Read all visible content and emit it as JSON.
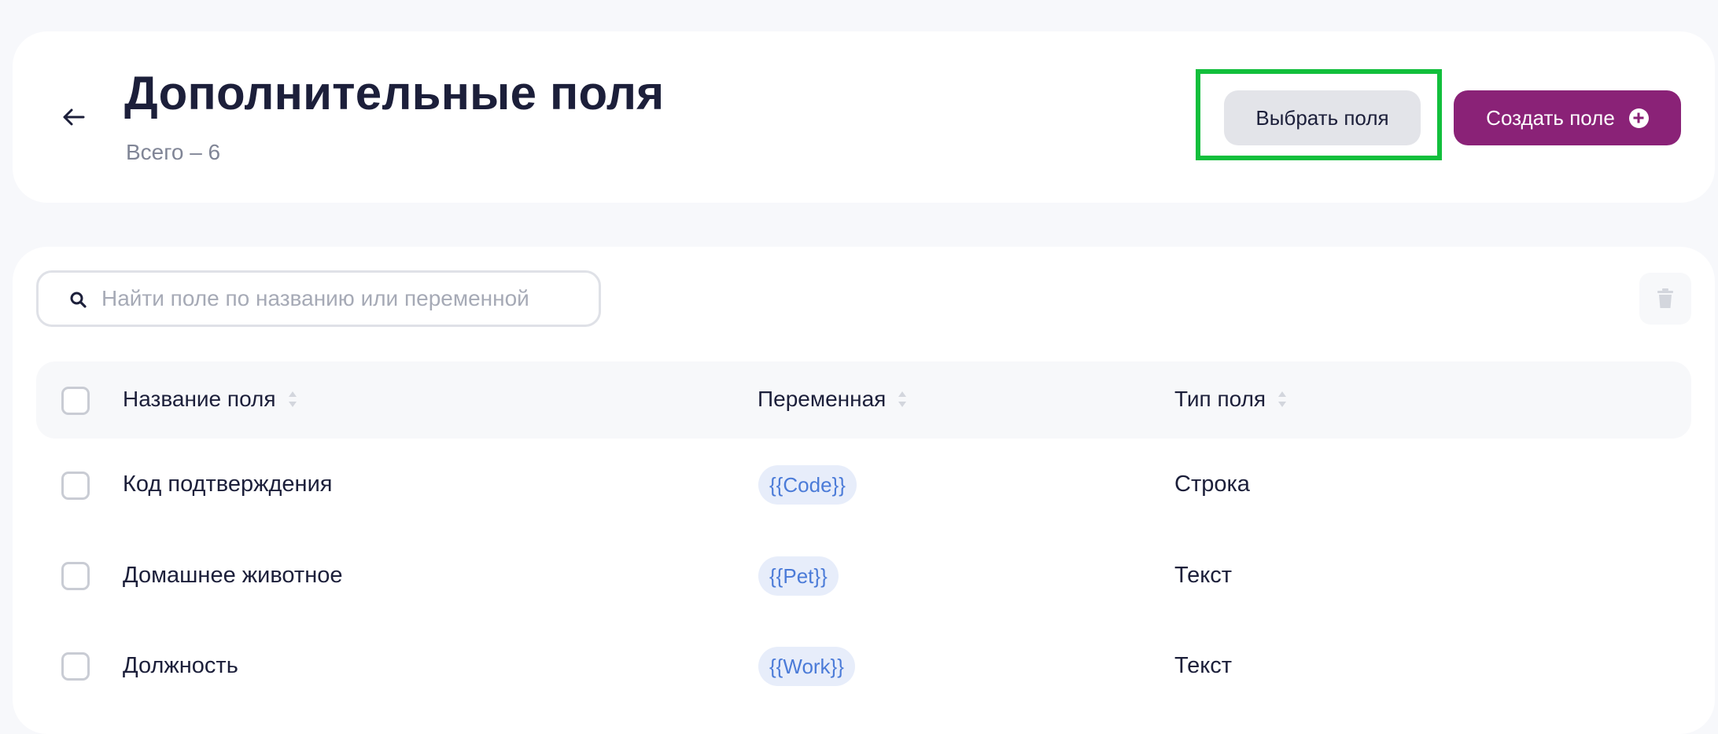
{
  "header": {
    "title": "Дополнительные поля",
    "subtitle": "Всего – 6",
    "select_fields_label": "Выбрать поля",
    "create_field_label": "Создать поле"
  },
  "search": {
    "placeholder": "Найти поле по названию или переменной",
    "value": ""
  },
  "table": {
    "columns": [
      "Название поля",
      "Переменная",
      "Тип поля"
    ],
    "rows": [
      {
        "name": "Код подтверждения",
        "variable": "{{Code}}",
        "type": "Строка"
      },
      {
        "name": "Домашнее животное",
        "variable": "{{Pet}}",
        "type": "Текст"
      },
      {
        "name": "Должность",
        "variable": "{{Work}}",
        "type": "Текст"
      }
    ]
  },
  "colors": {
    "accent": "#8a2277",
    "highlight": "#12bf3c",
    "variable_text": "#4b7bd8",
    "variable_bg": "#e7edfa"
  },
  "icons": [
    "back-arrow-icon",
    "plus-circle-icon",
    "search-icon",
    "trash-icon",
    "sort-icon"
  ]
}
